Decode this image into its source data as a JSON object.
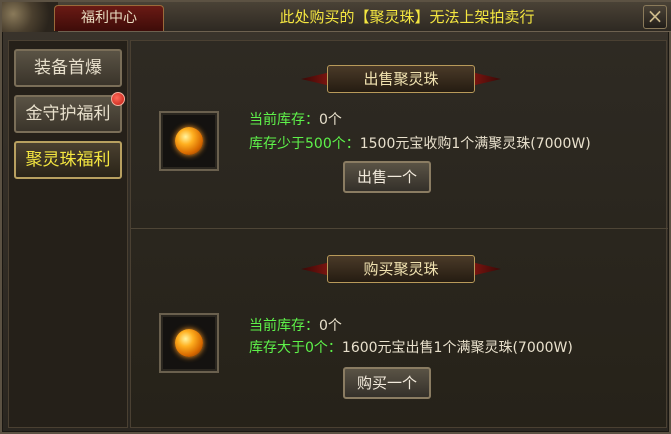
{
  "window": {
    "title_tab": "福利中心",
    "notice": "此处购买的【聚灵珠】无法上架拍卖行",
    "close_label": "×"
  },
  "sidebar": {
    "items": [
      {
        "label": "装备首爆",
        "active": false
      },
      {
        "label": "金守护福利",
        "active": false,
        "has_badge": true
      },
      {
        "label": "聚灵珠福利",
        "active": true
      }
    ]
  },
  "sell_section": {
    "banner": "出售聚灵珠",
    "stock_label": "当前库存：",
    "stock_value": "0个",
    "rule_label": "库存少于500个：",
    "rule_value": "1500元宝收购1个满聚灵珠(7000W)",
    "button": "出售一个"
  },
  "buy_section": {
    "banner": "购买聚灵珠",
    "stock_label": "当前库存：",
    "stock_value": "0个",
    "rule_label": "库存大于0个：",
    "rule_value": "1600元宝出售1个满聚灵珠(7000W)",
    "button": "购买一个"
  },
  "colors": {
    "notice": "#f4e640",
    "info_green": "#5ef24a",
    "active_text": "#f4e640"
  }
}
